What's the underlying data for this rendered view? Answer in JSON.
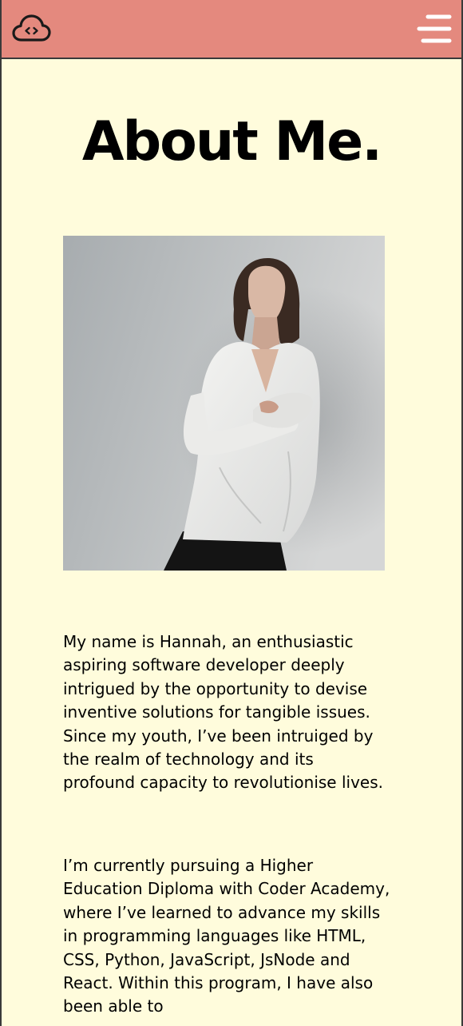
{
  "header": {
    "logo_icon": "cloud-code-icon",
    "menu_icon": "hamburger-menu-icon",
    "background": "#e4897e"
  },
  "page": {
    "background": "#fffcdc",
    "title": "About Me.",
    "photo_alt": "Portrait photo"
  },
  "bio": {
    "paragraph_1": "My name is Hannah, an enthusiastic aspiring software developer deeply intrigued by the opportunity to devise inventive solutions for tangible issues. Since my youth, I’ve been intruiged by the realm of technology and its profound capacity to revolutionise lives.",
    "paragraph_2": "I’m currently pursuing a Higher Education Diploma with Coder Academy, where I’ve learned to advance my skills in programming languages like HTML, CSS, Python, JavaScript, JsNode and React. Within this program, I have also been able to"
  }
}
